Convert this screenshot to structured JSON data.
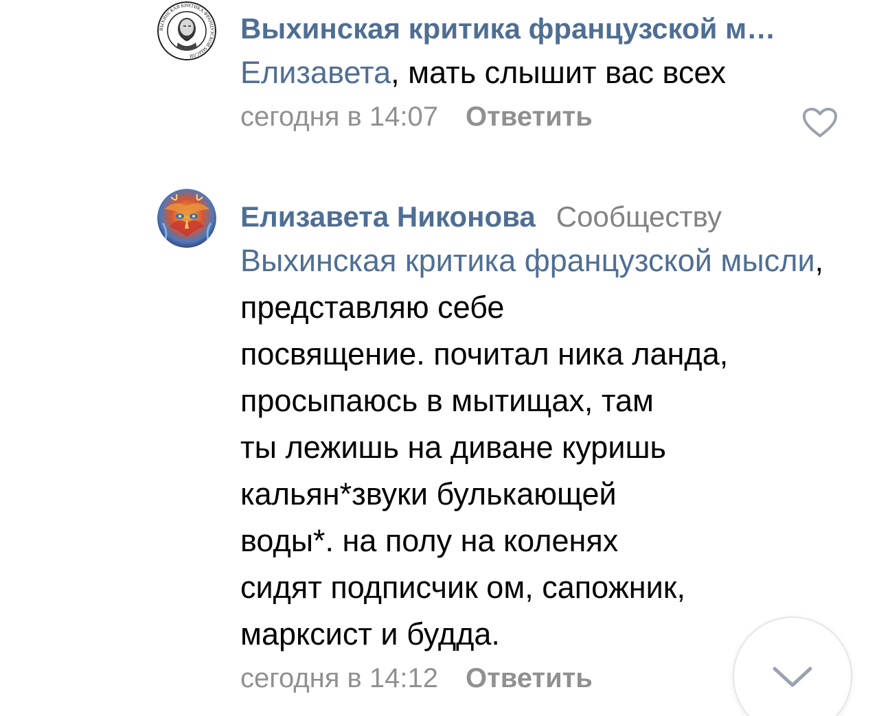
{
  "comments": [
    {
      "author": "Выхинская критика французской м…",
      "reply_to": "Елизавета",
      "text": ", мать слышит вас всех",
      "timestamp": "сегодня в 14:07",
      "reply_label": "Ответить",
      "avatar_icon": "philosopher-bust-seal-avatar",
      "avatar_seal_text": "ВЫХИНСКАЯ КРИТИКА ФРАНЦУЗСКОЙ МЫСЛИ",
      "like_icon": "heart-icon"
    },
    {
      "author": "Елизавета Никонова",
      "to_label": "Сообществу",
      "reply_to": "Выхинская критика французской мысли",
      "lines": [
        ", представляю себе",
        "посвящение. почитал ника ланда,",
        "просыпаюсь в мытищах, там",
        "ты лежишь на диване куришь",
        "кальян*звуки булькающей",
        "воды*. на полу на коленях",
        "сидят подписчик ом, сапожник,",
        "марксист и будда."
      ],
      "timestamp": "сегодня в 14:12",
      "reply_label": "Ответить",
      "avatar_icon": "psychedelic-art-avatar"
    }
  ],
  "scroll_button": {
    "icon": "chevron-down-icon"
  },
  "colors": {
    "link": "#4f6e94",
    "meta": "#909090",
    "text": "#000000",
    "background": "#ffffff"
  }
}
